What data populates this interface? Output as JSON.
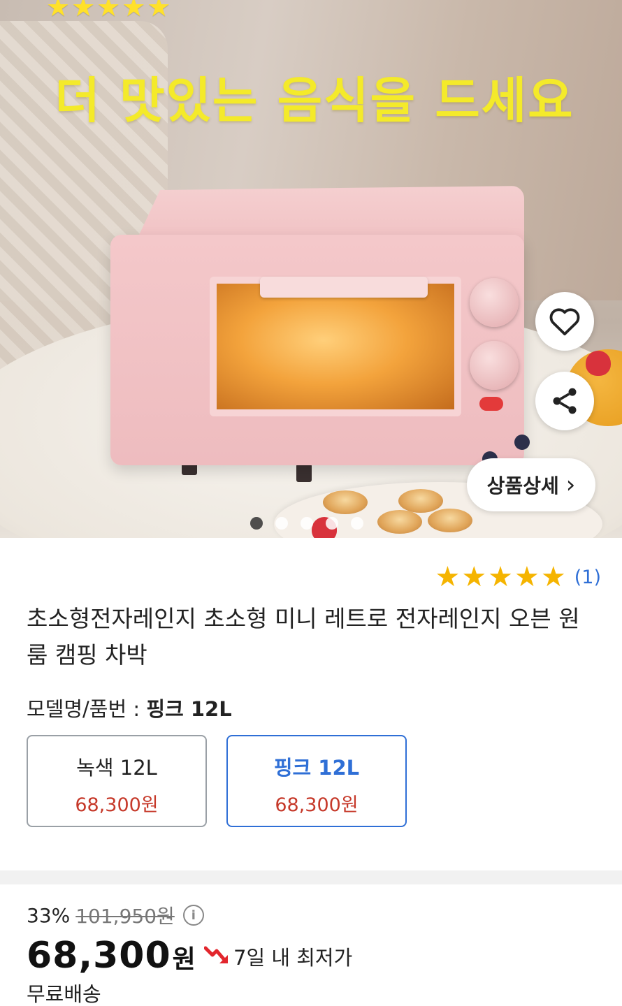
{
  "hero": {
    "headline": "더 맛있는 음식을 드세요",
    "stars": "★★★★★",
    "detail_button_label": "상품상세",
    "detail_button_chevron": "›",
    "slide_count": 5,
    "active_slide": 1
  },
  "product": {
    "rating": {
      "stars": 5,
      "count_label": "(1)"
    },
    "title": "초소형전자레인지 초소형 미니 레트로 전자레인지 오븐 원룸 캠핑 차박",
    "model_label": "모델명/품번 : ",
    "model_value": "핑크 12L",
    "options": [
      {
        "name": "녹색 12L",
        "price": "68,300원",
        "selected": false
      },
      {
        "name": "핑크 12L",
        "price": "68,300원",
        "selected": true
      }
    ]
  },
  "pricing": {
    "discount": "33%",
    "original_price": "101,950원",
    "price": "68,300",
    "currency": "원",
    "lowest_label": "7일 내 최저가",
    "shipping": "무료배송"
  },
  "colors": {
    "accent_blue": "#2f6fd6",
    "price_red": "#c6392a",
    "star_gold": "#f5b400",
    "headline_yellow": "#f4ea2a"
  },
  "icons": {
    "wishlist": "heart-icon",
    "share": "share-icon",
    "info": "info-icon",
    "lowest_price": "down-arrow-icon",
    "chevron": "chevron-right-icon"
  }
}
